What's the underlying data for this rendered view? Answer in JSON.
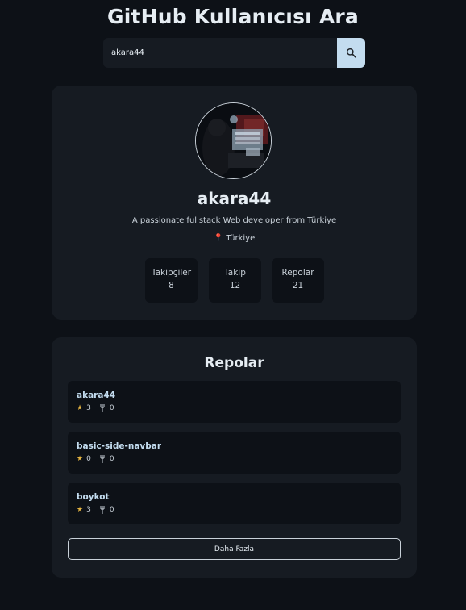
{
  "header": {
    "title": "GitHub Kullanıcısı Ara"
  },
  "search": {
    "value": "akara44",
    "button_icon": "search-icon"
  },
  "profile": {
    "avatar_icon": "avatar",
    "username": "akara44",
    "bio": "A passionate fullstack Web developer from Türkiye",
    "location": "Türkiye",
    "location_icon": "pin-icon",
    "stats": [
      {
        "label": "Takipçiler",
        "value": "8"
      },
      {
        "label": "Takip",
        "value": "12"
      },
      {
        "label": "Repolar",
        "value": "21"
      }
    ]
  },
  "repos": {
    "title": "Repolar",
    "items": [
      {
        "name": "akara44",
        "stars": "3",
        "forks": "0"
      },
      {
        "name": "basic-side-navbar",
        "stars": "0",
        "forks": "0"
      },
      {
        "name": "boykot",
        "stars": "3",
        "forks": "0"
      }
    ],
    "more_label": "Daha Fazla"
  },
  "colors": {
    "background": "#0d1117",
    "card": "#161b22",
    "accent": "#c3dcef",
    "star": "#e3b341"
  }
}
